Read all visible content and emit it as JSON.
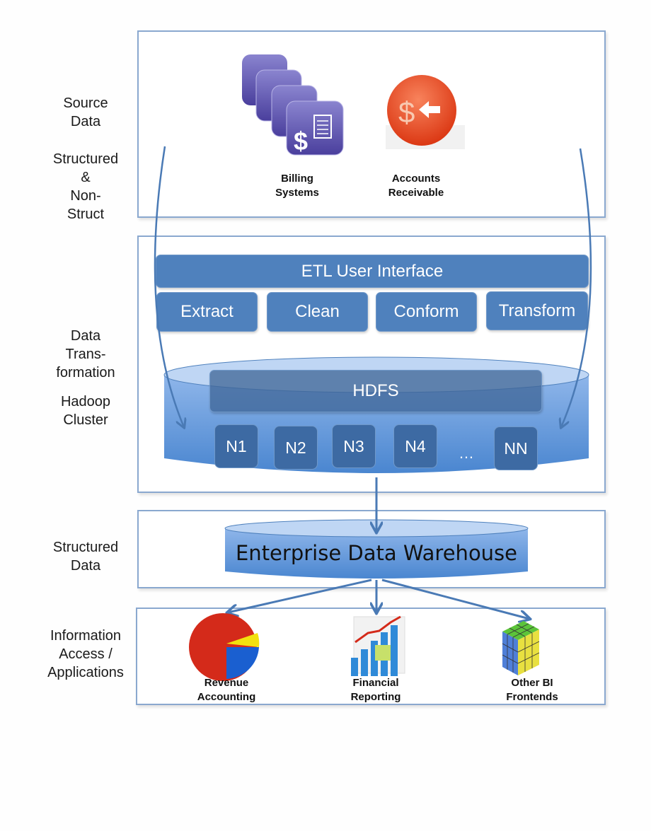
{
  "side_labels": {
    "source": "Source\nData",
    "structured_nonstruct": "Structured\n&\nNon-\nStruct",
    "transformation": "Data\nTrans-\nformation",
    "hadoop": "Hadoop\nCluster",
    "structured_data": "Structured\nData",
    "info_access": "Information\nAccess /\nApplications"
  },
  "sources": [
    {
      "label_line1": "Billing",
      "label_line2": "Systems",
      "icon": "billing-systems-icon"
    },
    {
      "label_line1": "Accounts",
      "label_line2": "Receivable",
      "icon": "accounts-receivable-icon"
    }
  ],
  "etl": {
    "title": "ETL User Interface",
    "steps": [
      "Extract",
      "Clean",
      "Conform",
      "Transform"
    ]
  },
  "hadoop": {
    "hdfs_label": "HDFS",
    "nodes": [
      "N1",
      "N2",
      "N3",
      "N4",
      "NN"
    ],
    "ellipsis": "…"
  },
  "warehouse": {
    "label": "Enterprise Data Warehouse"
  },
  "applications": [
    {
      "label_line1": "Revenue",
      "label_line2": "Accounting",
      "icon": "pie-chart-icon"
    },
    {
      "label_line1": "Financial",
      "label_line2": "Reporting",
      "icon": "bar-chart-icon"
    },
    {
      "label_line1": "Other BI",
      "label_line2": "Frontends",
      "icon": "cube-icon"
    }
  ],
  "colors": {
    "panel_border": "#8aa8cf",
    "box_blue": "#4f81bd",
    "node_blue": "#3d6aa3",
    "arrow": "#4a7ab5"
  }
}
